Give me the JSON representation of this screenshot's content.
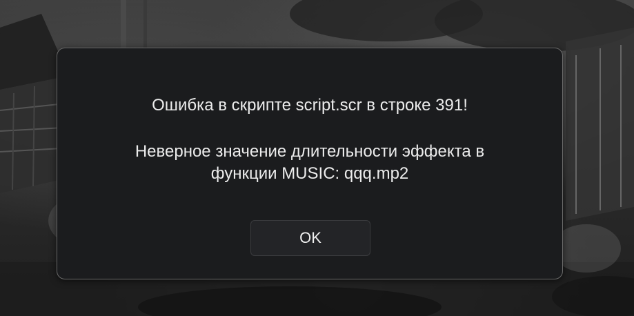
{
  "dialog": {
    "title_line": "Ошибка в скрипте script.scr в строке 391!",
    "detail_line_1": "Неверное значение длительности эффекта в",
    "detail_line_2": "функции MUSIC: qqq.mp2",
    "ok_label": "OK"
  },
  "colors": {
    "dialog_background": "#1b1c1e",
    "dialog_border": "#6b6b6b",
    "text": "#ececec",
    "button_background": "#232427"
  }
}
